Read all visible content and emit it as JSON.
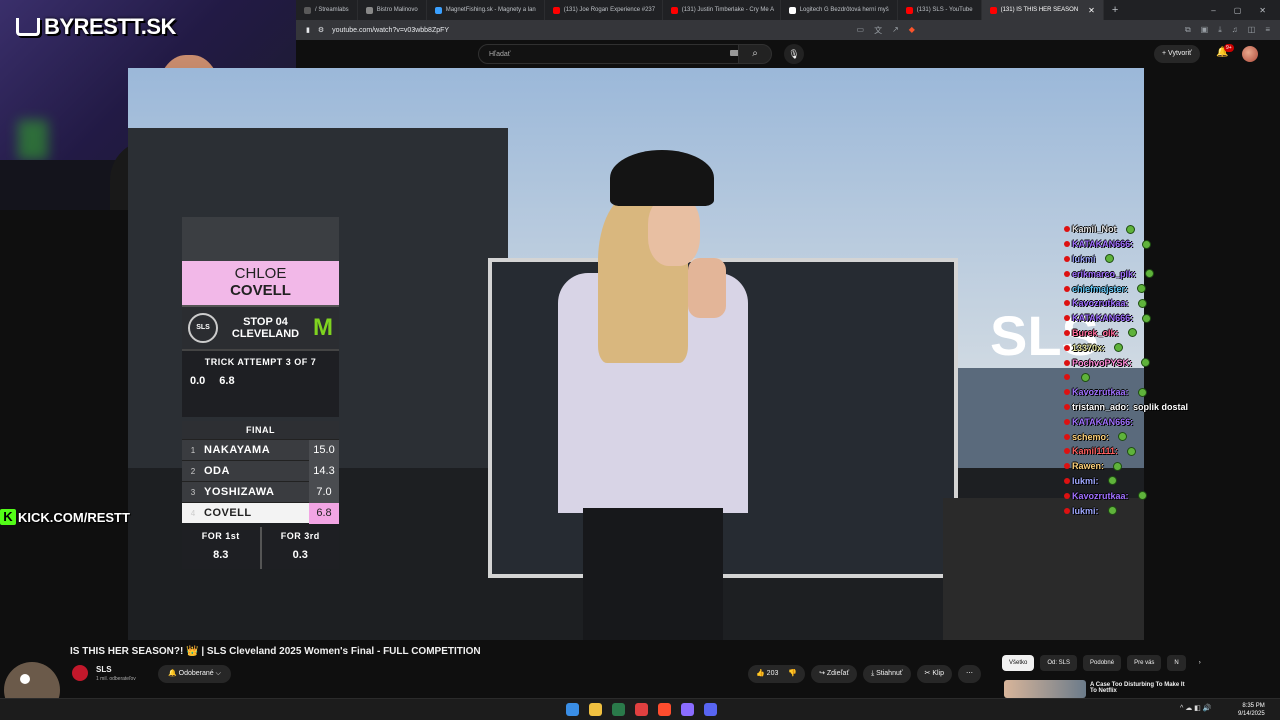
{
  "browser": {
    "tabs": [
      {
        "label": "/ Streamlabs",
        "color": "#5a5a5a",
        "active": false
      },
      {
        "label": "Bistro Malinovo",
        "color": "#888888",
        "active": false
      },
      {
        "label": "MagnetFishing.sk - Magnety a lan",
        "color": "#3aa0ff",
        "active": false
      },
      {
        "label": "(131) Joe Rogan Experience #237",
        "color": "#ff0000",
        "active": false
      },
      {
        "label": "(131) Justin Timberlake - Cry Me A",
        "color": "#ff0000",
        "active": false
      },
      {
        "label": "Logitech G Bezdrôtová herní myš",
        "color": "#ffffff",
        "active": false
      },
      {
        "label": "(131) SLS - YouTube",
        "color": "#ff0000",
        "active": false
      },
      {
        "label": "(131) IS THIS HER SEASON",
        "color": "#ff0000",
        "active": true
      }
    ],
    "new_tab_label": "+",
    "window_controls": [
      "–",
      "▢",
      "✕"
    ],
    "url": "youtube.com/watch?v=v03wbb8ZpFY"
  },
  "youtube": {
    "search_placeholder": "Hľadať",
    "create_label": "+ Vytvoriť",
    "notification_count": "9+"
  },
  "overlay": {
    "brand": "BYRESTT.SK",
    "kick_text": "KICK.COM/RESTT",
    "kick_letter": "K"
  },
  "scoreboard": {
    "first_name": "CHLOE",
    "last_name": "COVELL",
    "league_badge": "SLS",
    "stop_line1": "STOP 04",
    "stop_line2": "CLEVELAND",
    "sponsor_icon": "monster-icon",
    "attempt_title": "TRICK ATTEMPT 3 OF 7",
    "attempt_scores": [
      "0.0",
      "6.8"
    ],
    "final_label": "FINAL",
    "standings": [
      {
        "rank": "1",
        "name": "NAKAYAMA",
        "score": "15.0",
        "highlight": false
      },
      {
        "rank": "2",
        "name": "ODA",
        "score": "14.3",
        "highlight": false
      },
      {
        "rank": "3",
        "name": "YOSHIZAWA",
        "score": "7.0",
        "highlight": false
      },
      {
        "rank": "4",
        "name": "COVELL",
        "score": "6.8",
        "highlight": true
      }
    ],
    "for_first_label": "FOR 1st",
    "for_first_value": "8.3",
    "for_third_label": "FOR 3rd",
    "for_third_value": "0.3"
  },
  "video_scene": {
    "sign_text": "SLS"
  },
  "chat": [
    {
      "user": "Kamil_Not",
      "color": "#e6e6e6",
      "msg": "",
      "emote": true
    },
    {
      "user": "KATAKAN666:",
      "color": "#a070ff",
      "msg": "",
      "emote": true
    },
    {
      "user": "lukmi",
      "color": "#9fa8ff",
      "msg": "",
      "emote": true
    },
    {
      "user": "erikmarco_plk:",
      "color": "#a070ff",
      "msg": "",
      "emote": true
    },
    {
      "user": "chiefmajster:",
      "color": "#6ad0ff",
      "msg": "",
      "emote": true
    },
    {
      "user": "Kavozrutkaa:",
      "color": "#a070ff",
      "msg": "",
      "emote": true
    },
    {
      "user": "KATAKAN666:",
      "color": "#a070ff",
      "msg": "",
      "emote": true
    },
    {
      "user": "Burek_olk:",
      "color": "#ff6a9a",
      "msg": "",
      "emote": true
    },
    {
      "user": "13370x:",
      "color": "#e6e6a0",
      "msg": "",
      "emote": true
    },
    {
      "user": "PochvoPYSK:",
      "color": "#ff8ad8",
      "msg": "",
      "emote": true
    },
    {
      "user": "",
      "color": "#ffffff",
      "msg": "",
      "emote": true
    },
    {
      "user": "Kavozrutkaa:",
      "color": "#a070ff",
      "msg": "",
      "emote": true
    },
    {
      "user": "tristann_ado:",
      "color": "#ffffff",
      "msg": "soplik dostal",
      "emote": false
    },
    {
      "user": "KATAKAN666:",
      "color": "#a070ff",
      "msg": "",
      "emote": false
    },
    {
      "user": "schemo:",
      "color": "#ffd27a",
      "msg": "",
      "emote": true
    },
    {
      "user": "Kamil1111:",
      "color": "#ff6060",
      "msg": "",
      "emote": true
    },
    {
      "user": "Rawen:",
      "color": "#ffd27a",
      "msg": "",
      "emote": true
    },
    {
      "user": "lukmi:",
      "color": "#9fa8ff",
      "msg": "",
      "emote": true
    },
    {
      "user": "Kavozrutkaa:",
      "color": "#a070ff",
      "msg": "",
      "emote": true
    },
    {
      "user": "lukmi:",
      "color": "#9fa8ff",
      "msg": "",
      "emote": true
    }
  ],
  "below": {
    "title": "IS THIS HER SEASON?! 👑 | SLS Cleveland 2025 Women's Final - FULL COMPETITION",
    "channel": "SLS",
    "subscribers": "1 mil. odberateľov",
    "subscribed_label": "🔔 Odoberané ⌵",
    "like_count": "203",
    "share_label": "Zdieľať",
    "download_label": "Stiahnuť",
    "clip_label": "Klip",
    "more_label": "⋯",
    "chips": [
      "Všetko",
      "Od: SLS",
      "Podobné",
      "Pre vás",
      "N"
    ],
    "rec_title": "A Case Too Disturbing To Make It To Netflix"
  },
  "taskbar": {
    "tray_icons": "^ ☁ ◧ 🔊",
    "time": "8:35 PM",
    "date": "9/14/2025",
    "icon_colors": [
      "#3a8ee6",
      "#f0c040",
      "#2a7a4a",
      "#e04040",
      "#ff4d2e",
      "#8a6cff",
      "#5865f2"
    ]
  }
}
